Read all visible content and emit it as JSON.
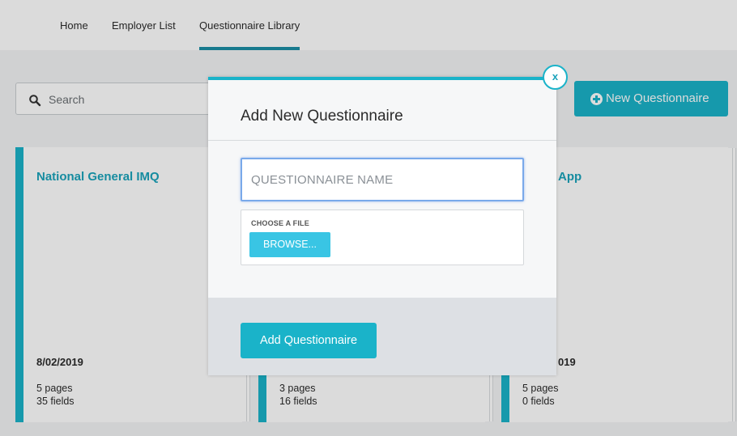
{
  "nav": {
    "items": [
      {
        "label": "Home"
      },
      {
        "label": "Employer List"
      },
      {
        "label": "Questionnaire Library"
      }
    ]
  },
  "search": {
    "placeholder": "Search"
  },
  "toolbar": {
    "new_questionnaire_label": "New Questionnaire"
  },
  "cards": [
    {
      "title": "National General IMQ",
      "date": "8/02/2019",
      "pages": "5 pages",
      "fields": "35 fields"
    },
    {
      "title": "",
      "date": "",
      "pages": "3 pages",
      "fields": "16 fields"
    },
    {
      "title": "App",
      "date": "019",
      "pages": "5 pages",
      "fields": "0 fields"
    }
  ],
  "modal": {
    "title": "Add New Questionnaire",
    "name_placeholder": "QUESTIONNAIRE NAME",
    "file_label": "CHOOSE A FILE",
    "browse_label": "BROWSE...",
    "submit_label": "Add Questionnaire",
    "close_label": "x"
  },
  "colors": {
    "accent": "#1ab3c9",
    "nav_underline": "#1c8ea6",
    "browse": "#39c5e4"
  }
}
